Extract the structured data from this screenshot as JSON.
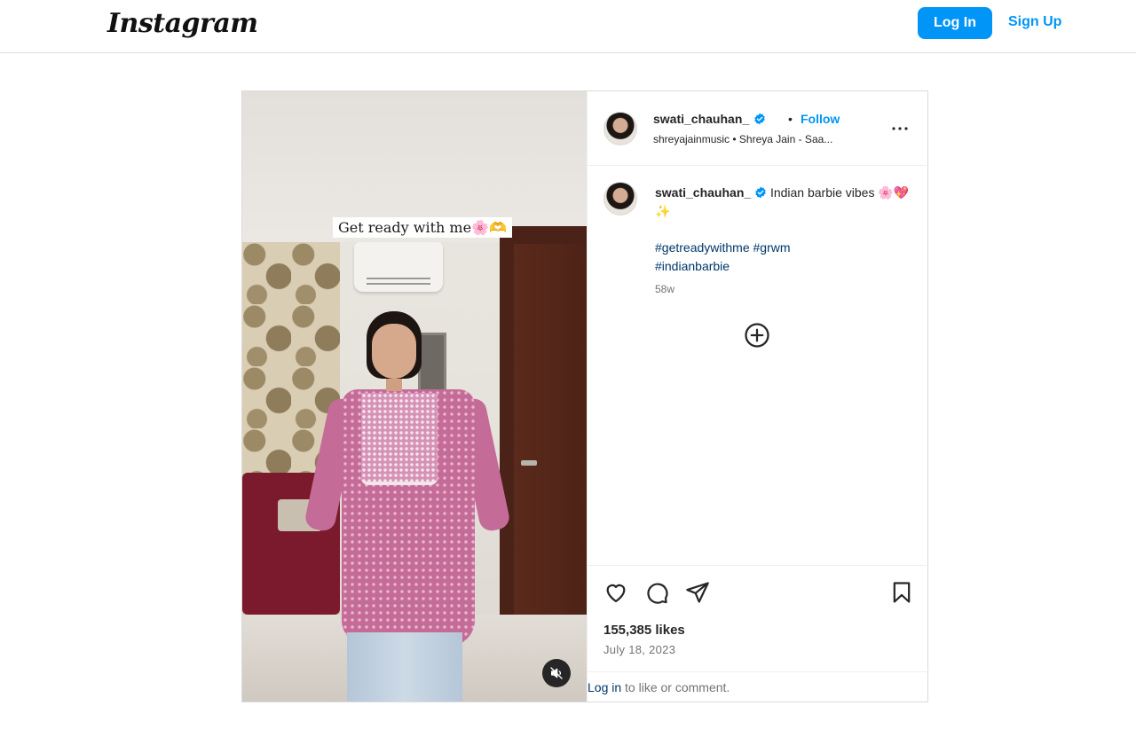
{
  "header": {
    "logo_text": "Instagram",
    "login_label": "Log In",
    "signup_label": "Sign Up",
    "accent_color": "#0095f6"
  },
  "post": {
    "media": {
      "overlay_text": "Get ready with me🌸🫶",
      "mute_icon": "speaker-muted-icon"
    },
    "author": {
      "username": "swati_chauhan_",
      "verified_icon": "verified-badge-icon",
      "follow_label": "Follow",
      "audio_text": "shreyajainmusic • Shreya Jain - Saa...",
      "more_icon": "more-options-icon"
    },
    "caption": {
      "username": "swati_chauhan_",
      "text": "Indian barbie vibes 🌸💖✨",
      "hashtags": [
        "#getreadywithme",
        "#grwm",
        "#indianbarbie"
      ],
      "time_ago": "58w",
      "load_more_icon": "plus-circle-icon"
    },
    "actions": {
      "icons": [
        "heart-icon",
        "comment-icon",
        "share-icon",
        "bookmark-icon"
      ],
      "likes": "155,385 likes",
      "date": "July 18, 2023"
    },
    "login_prompt": {
      "link": "Log in",
      "text": " to like or comment."
    }
  }
}
